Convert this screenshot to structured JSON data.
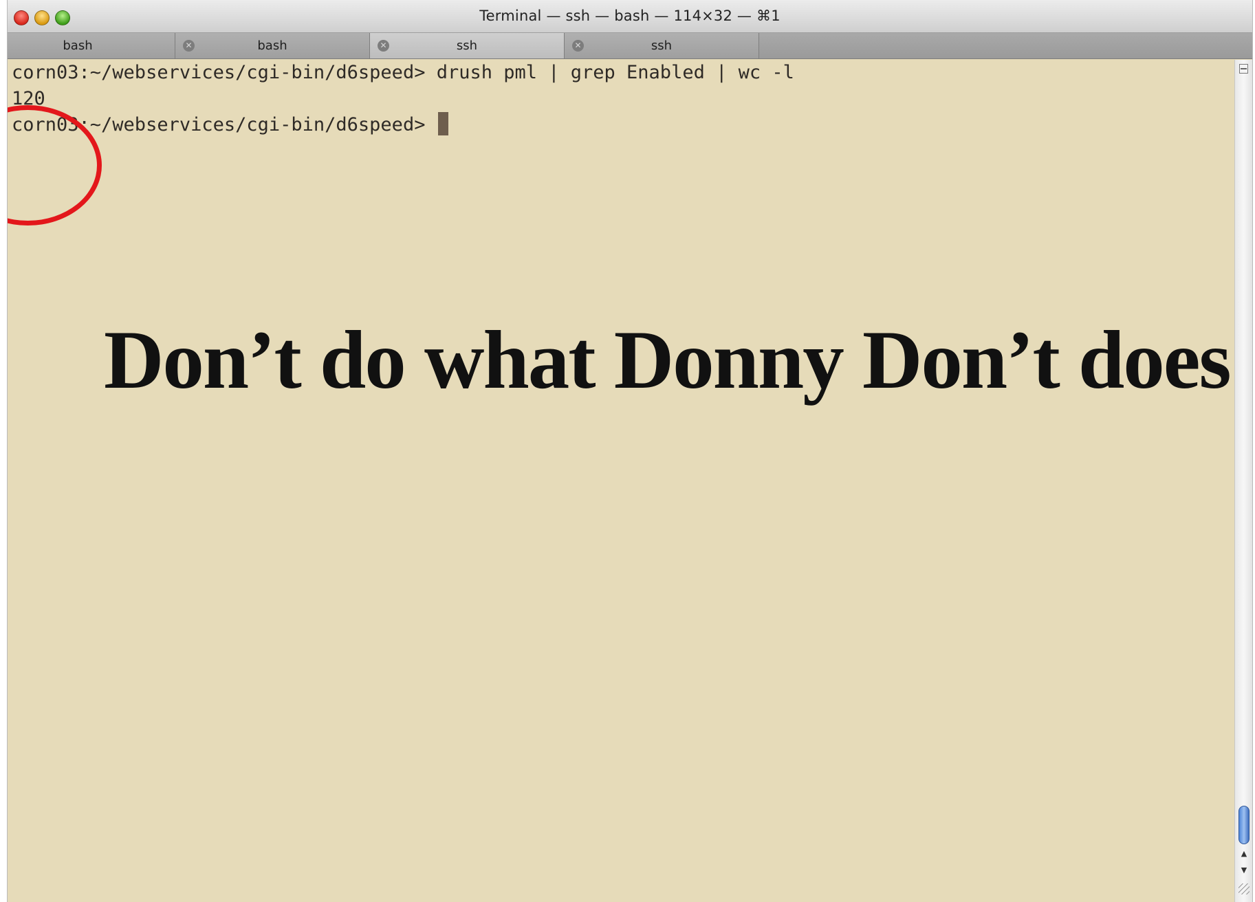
{
  "window": {
    "title": "Terminal — ssh — bash — 114×32 — ⌘1"
  },
  "tabs": [
    {
      "label": "bash",
      "active": false
    },
    {
      "label": "bash",
      "active": false
    },
    {
      "label": "ssh",
      "active": true
    },
    {
      "label": "ssh",
      "active": false
    }
  ],
  "terminal": {
    "lines": [
      "corn03:~/webservices/cgi-bin/d6speed> drush pml | grep Enabled | wc -l",
      "120",
      "corn03:~/webservices/cgi-bin/d6speed> "
    ]
  },
  "overlay": {
    "caption": "Don’t do what Donny Don’t does"
  },
  "icons": {
    "tab_close": "close-circle-icon",
    "scroll_up": "arrow-up-icon",
    "scroll_down": "arrow-down-icon"
  },
  "colors": {
    "terminal_background": "#e6dbb9",
    "terminal_text": "#2e2a26",
    "annotation": "#e3171b",
    "scroll_thumb": "#4f86d9"
  }
}
